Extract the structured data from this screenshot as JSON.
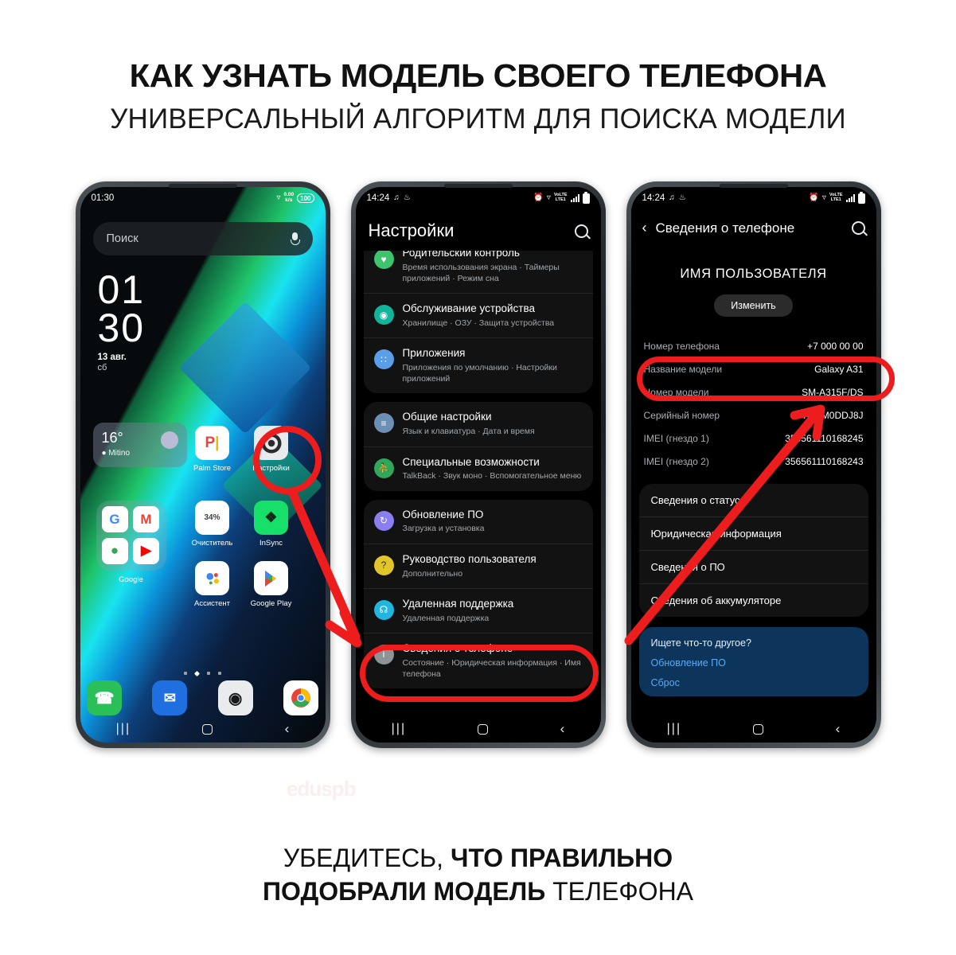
{
  "header": {
    "title": "КАК УЗНАТЬ МОДЕЛЬ СВОЕГО ТЕЛЕФОНА",
    "subtitle": "УНИВЕРСАЛЬНЫЙ АЛГОРИТМ ДЛЯ ПОИСКА МОДЕЛИ"
  },
  "watermark": "eduspb",
  "footer": {
    "line1_normal": "УБЕДИТЕСЬ,",
    "line1_bold": "ЧТО ПРАВИЛЬНО",
    "line2_bold": "ПОДОБРАЛИ МОДЕЛЬ",
    "line2_normal": "ТЕЛЕФОНА"
  },
  "accent_color": "#ee1d1d",
  "phone1": {
    "status": {
      "time": "01:30",
      "netspeed_value": "0.00",
      "netspeed_unit": "k/s",
      "battery": "100",
      "wifi_icon": "wifi-icon"
    },
    "search": {
      "placeholder": "Поиск",
      "mic_icon": "microphone-icon"
    },
    "clock": {
      "hours": "01",
      "minutes": "30",
      "date": "13 авг.",
      "weekday": "сб"
    },
    "weather": {
      "temp": "16°",
      "city": "Mitino"
    },
    "apps_row1": [
      {
        "label": "Palm Store",
        "icon": "palm-store-icon"
      },
      {
        "label": "Настройки",
        "icon": "gear-icon"
      }
    ],
    "folder": {
      "label": "Google",
      "apps": [
        "google-icon",
        "gmail-icon",
        "maps-icon",
        "youtube-icon"
      ]
    },
    "apps_row2": [
      {
        "label": "Очиститель",
        "icon": "cleaner-icon",
        "badge": "34%"
      },
      {
        "label": "InSync",
        "icon": "insync-icon"
      }
    ],
    "apps_row3": [
      {
        "label": "Ассистент",
        "icon": "google-assistant-icon"
      },
      {
        "label": "Google Play",
        "icon": "google-play-icon"
      }
    ],
    "dock": [
      {
        "label": "Телефон",
        "icon": "phone-icon"
      },
      {
        "label": "Сообщения",
        "icon": "messages-icon"
      },
      {
        "label": "Камера",
        "icon": "camera-icon"
      },
      {
        "label": "Chrome",
        "icon": "chrome-icon"
      }
    ],
    "nav": {
      "recents": "recents-icon",
      "home": "home-icon",
      "back": "back-icon"
    }
  },
  "phone2": {
    "status": {
      "time": "14:24",
      "alarm_icon": "alarm-icon",
      "wifi_icon": "wifi-icon",
      "volte": "VoLTE",
      "network": "LTE1"
    },
    "title": "Настройки",
    "search_icon": "search-icon",
    "groups": [
      {
        "items": [
          {
            "title": "Родительский контроль",
            "sub": "Время использования экрана  ·  Таймеры приложений  ·  Режим сна",
            "icon": "parental-control-icon",
            "color": "#3ec46d"
          },
          {
            "title": "Обслуживание устройства",
            "sub": "Хранилище  ·  ОЗУ  ·  Защита устройства",
            "icon": "device-care-icon",
            "color": "#12b59a"
          },
          {
            "title": "Приложения",
            "sub": "Приложения по умолчанию  ·  Настройки приложений",
            "icon": "apps-icon",
            "color": "#5a9ee8"
          }
        ]
      },
      {
        "items": [
          {
            "title": "Общие настройки",
            "sub": "Язык и клавиатура  ·  Дата и время",
            "icon": "sliders-icon",
            "color": "#6d8fb5"
          },
          {
            "title": "Специальные возможности",
            "sub": "TalkBack  ·  Звук моно  ·  Вспомогательное меню",
            "icon": "accessibility-icon",
            "color": "#2fa85c"
          }
        ]
      },
      {
        "items": [
          {
            "title": "Обновление ПО",
            "sub": "Загрузка и установка",
            "icon": "software-update-icon",
            "color": "#8b7ef0"
          },
          {
            "title": "Руководство пользователя",
            "sub": "Дополнительно",
            "icon": "user-manual-icon",
            "color": "#e2c52a"
          },
          {
            "title": "Удаленная поддержка",
            "sub": "Удаленная поддержка",
            "icon": "headset-icon",
            "color": "#21b6e0"
          },
          {
            "title": "Сведения о телефоне",
            "sub": "Состояние  ·  Юридическая информация  ·  Имя телефона",
            "icon": "info-icon",
            "color": "#8e9396"
          }
        ]
      }
    ],
    "nav": {
      "recents": "recents-icon",
      "home": "home-icon",
      "back": "back-icon"
    }
  },
  "phone3": {
    "status": {
      "time": "14:24",
      "alarm_icon": "alarm-icon",
      "wifi_icon": "wifi-icon",
      "volte": "VoLTE",
      "network": "LTE1"
    },
    "title": "Сведения о телефоне",
    "back_icon": "back-chevron-icon",
    "search_icon": "search-icon",
    "user_name": "ИМЯ ПОЛЬЗОВАТЕЛЯ",
    "edit_button": "Изменить",
    "info_rows": [
      {
        "key": "Номер телефона",
        "value": "+7 000 00 00"
      },
      {
        "key": "Название модели",
        "value": "Galaxy A31"
      },
      {
        "key": "Номер модели",
        "value": "SM-A315F/DS"
      },
      {
        "key": "Серийный номер",
        "value": "RF8M0DDJ8J"
      },
      {
        "key": "IMEI (гнездо 1)",
        "value": "356561110168245"
      },
      {
        "key": "IMEI (гнездо 2)",
        "value": "356561110168243"
      }
    ],
    "list_items": [
      "Сведения о статусе",
      "Юридическая информация",
      "Сведения о ПО",
      "Сведения об аккумуляторе"
    ],
    "blue_card": {
      "title": "Ищете что-то другое?",
      "link1": "Обновление ПО",
      "link2": "Сброс"
    },
    "nav": {
      "recents": "recents-icon",
      "home": "home-icon",
      "back": "back-icon"
    }
  }
}
